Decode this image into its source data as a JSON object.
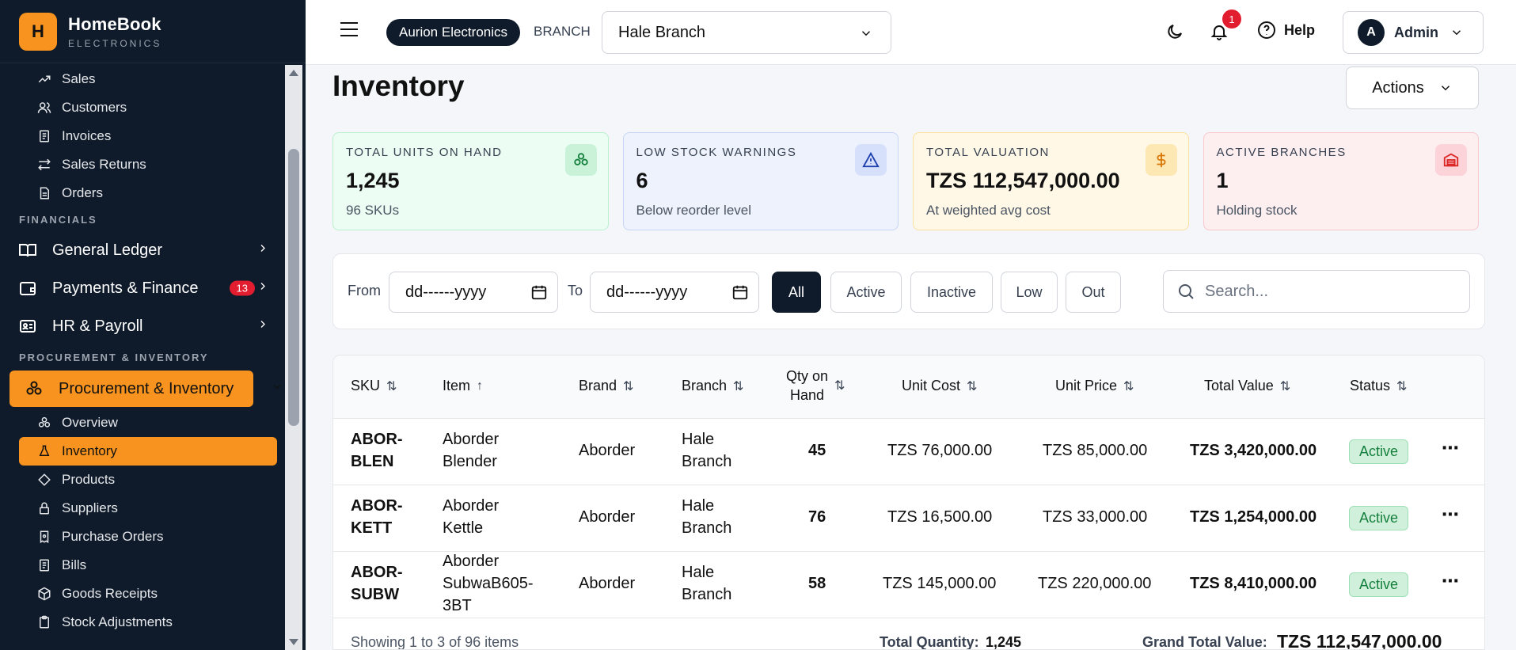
{
  "brand": {
    "logo_letter": "H",
    "name": "HomeBook",
    "subtitle": "ELECTRONICS"
  },
  "sidebar": {
    "sales_items": [
      {
        "label": "Sales",
        "icon": "trending-up-icon"
      },
      {
        "label": "Customers",
        "icon": "users-icon"
      },
      {
        "label": "Invoices",
        "icon": "invoice-icon"
      },
      {
        "label": "Sales Returns",
        "icon": "swap-icon"
      },
      {
        "label": "Orders",
        "icon": "document-icon"
      }
    ],
    "financials_label": "FINANCIALS",
    "general_ledger": "General Ledger",
    "payments_finance": "Payments & Finance",
    "payments_badge": "13",
    "hr_payroll": "HR & Payroll",
    "procurement_label": "PROCUREMENT & INVENTORY",
    "procurement_group": "Procurement & Inventory",
    "procurement_items": [
      {
        "label": "Overview"
      },
      {
        "label": "Inventory"
      },
      {
        "label": "Products"
      },
      {
        "label": "Suppliers"
      },
      {
        "label": "Purchase Orders"
      },
      {
        "label": "Bills"
      },
      {
        "label": "Goods Receipts"
      },
      {
        "label": "Stock Adjustments"
      }
    ]
  },
  "topbar": {
    "company": "Aurion Electronics",
    "branch_label": "BRANCH",
    "branch_value": "Hale Branch",
    "notifications": "1",
    "help": "Help",
    "avatar_letter": "A",
    "user": "Admin"
  },
  "page": {
    "title": "Inventory",
    "actions": "Actions"
  },
  "stats": [
    {
      "label": "TOTAL UNITS ON HAND",
      "value": "1,245",
      "sub": "96 SKUs",
      "icon": "boxes-icon",
      "color": "#15803d"
    },
    {
      "label": "LOW STOCK WARNINGS",
      "value": "6",
      "sub": "Below reorder level",
      "icon": "warning-icon",
      "color": "#1e40af"
    },
    {
      "label": "TOTAL VALUATION",
      "value": "TZS 112,547,000.00",
      "sub": "At weighted avg cost",
      "icon": "dollar-icon",
      "color": "#d97706"
    },
    {
      "label": "ACTIVE BRANCHES",
      "value": "1",
      "sub": "Holding stock",
      "icon": "warehouse-icon",
      "color": "#dc2626"
    }
  ],
  "filters": {
    "from_label": "From",
    "to_label": "To",
    "from_placeholder": "dd------yyyy",
    "to_placeholder": "dd------yyyy",
    "chips": [
      "All",
      "Active",
      "Inactive",
      "Low",
      "Out"
    ],
    "selected_chip": "All",
    "search_placeholder": "Search..."
  },
  "table": {
    "headers": {
      "sku": "SKU",
      "item": "Item",
      "brand": "Brand",
      "branch": "Branch",
      "qty_line1": "Qty on",
      "qty_line2": "Hand",
      "unit_cost": "Unit Cost",
      "unit_price": "Unit Price",
      "total_value": "Total Value",
      "status": "Status"
    },
    "rows": [
      {
        "sku1": "ABOR-",
        "sku2": "BLEN",
        "item1": "Aborder",
        "item2": "Blender",
        "item3": "",
        "brand": "Aborder",
        "branch1": "Hale",
        "branch2": "Branch",
        "qty": "45",
        "unit_cost": "TZS 76,000.00",
        "unit_price": "TZS 85,000.00",
        "total": "TZS 3,420,000.00",
        "status": "Active"
      },
      {
        "sku1": "ABOR-",
        "sku2": "KETT",
        "item1": "Aborder",
        "item2": "Kettle",
        "item3": "",
        "brand": "Aborder",
        "branch1": "Hale",
        "branch2": "Branch",
        "qty": "76",
        "unit_cost": "TZS 16,500.00",
        "unit_price": "TZS 33,000.00",
        "total": "TZS 1,254,000.00",
        "status": "Active"
      },
      {
        "sku1": "ABOR-",
        "sku2": "SUBW",
        "item1": "Aborder",
        "item2": "SubwaB605-",
        "item3": "3BT",
        "brand": "Aborder",
        "branch1": "Hale",
        "branch2": "Branch",
        "qty": "58",
        "unit_cost": "TZS 145,000.00",
        "unit_price": "TZS 220,000.00",
        "total": "TZS 8,410,000.00",
        "status": "Active"
      }
    ],
    "footer": {
      "showing": "Showing 1 to 3 of 96 items",
      "total_qty_label": "Total Quantity:",
      "total_qty": "1,245",
      "grand_total_label": "Grand Total Value:",
      "grand_total": "TZS 112,547,000.00"
    }
  }
}
